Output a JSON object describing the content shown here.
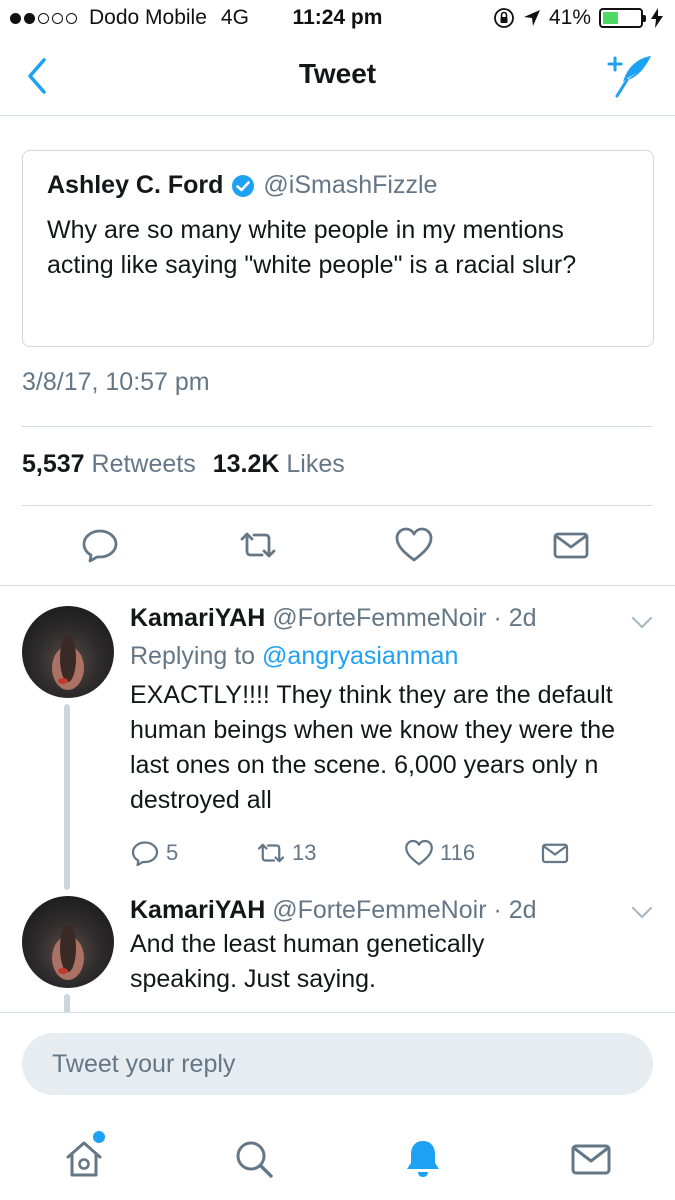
{
  "status": {
    "carrier": "Dodo Mobile",
    "network": "4G",
    "time": "11:24 pm",
    "battery": "41%",
    "battery_level": 0.41,
    "battery_color": "#4cd964"
  },
  "nav": {
    "title": "Tweet",
    "accent": "#1da1f2"
  },
  "tweet": {
    "name": "Ashley C. Ford",
    "handle": "@iSmashFizzle",
    "text": "Why are so many white people in my mentions acting like saying \"white people\" is a racial slur?",
    "timestamp": "3/8/17, 10:57 pm",
    "retweets_count": "5,537",
    "retweets_label": "Retweets",
    "likes_count": "13.2K",
    "likes_label": "Likes"
  },
  "replies": [
    {
      "name": "KamariYAH",
      "handle": "@ForteFemmeNoir",
      "time": "· 2d",
      "replying_prefix": "Replying to",
      "replying_to": "@angryasianman",
      "text": "EXACTLY!!!! They think they are the default human beings when we know they were the last ones on the scene. 6,000 years only n destroyed all",
      "reply_count": "5",
      "retweet_count": "13",
      "like_count": "116"
    },
    {
      "name": "KamariYAH",
      "handle": "@ForteFemmeNoir",
      "time": "· 2d",
      "text": "And the least human genetically speaking. Just saying."
    }
  ],
  "composer": {
    "placeholder": "Tweet your reply"
  },
  "tabbar": [
    "home-icon",
    "search-icon",
    "notifications-icon",
    "messages-icon"
  ]
}
